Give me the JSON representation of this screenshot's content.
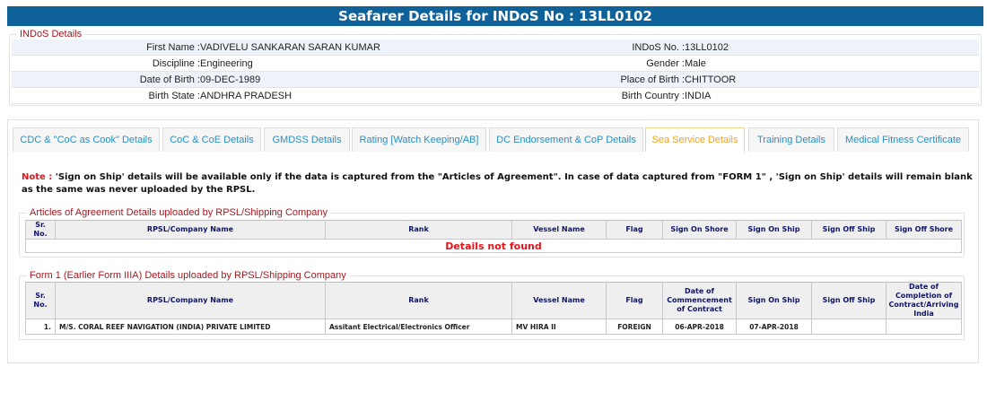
{
  "header": {
    "title": "Seafarer Details for INDoS No : 13LL0102"
  },
  "indos": {
    "legend": "INDoS Details",
    "rows": [
      {
        "l1": "First Name :",
        "v1": "VADIVELU SANKARAN SARAN KUMAR",
        "l2": "INDoS No. :",
        "v2": "13LL0102"
      },
      {
        "l1": "Discipline :",
        "v1": "Engineering",
        "l2": "Gender :",
        "v2": "Male"
      },
      {
        "l1": "Date of Birth :",
        "v1": "09-DEC-1989",
        "l2": "Place of Birth :",
        "v2": "CHITTOOR"
      },
      {
        "l1": "Birth State :",
        "v1": "ANDHRA PRADESH",
        "l2": "Birth Country :",
        "v2": "INDIA"
      }
    ]
  },
  "tabs": [
    "CDC & \"CoC as Cook\" Details",
    "CoC & CoE Details",
    "GMDSS Details",
    "Rating [Watch Keeping/AB]",
    "DC Endorsement & CoP Details",
    "Sea Service Details",
    "Training Details",
    "Medical Fitness Certificate"
  ],
  "note": {
    "label": "Note :",
    "text": " 'Sign on Ship' details will be available only if the data is captured from the \"Articles of Agreement\". In case of data captured from \"FORM 1\" , 'Sign on Ship' details will remain blank as the same was never uploaded by the RPSL."
  },
  "aoa": {
    "legend": "Articles of Agreement Details uploaded by RPSL/Shipping Company",
    "headers": [
      "Sr. No.",
      "RPSL/Company Name",
      "Rank",
      "Vessel Name",
      "Flag",
      "Sign On Shore",
      "Sign On Ship",
      "Sign Off Ship",
      "Sign Off Shore"
    ],
    "empty": "Details not found"
  },
  "form1": {
    "legend": "Form 1 (Earlier Form IIIA) Details uploaded by RPSL/Shipping Company",
    "headers": [
      "Sr. No.",
      "RPSL/Company Name",
      "Rank",
      "Vessel Name",
      "Flag",
      "Date of Commencement of Contract",
      "Sign On Ship",
      "Sign Off Ship",
      "Date of Completion of Contract/Arriving India"
    ],
    "rows": [
      [
        "1.",
        "M/S. CORAL REEF NAVIGATION (INDIA) PRIVATE LIMITED",
        "Assitant Electrical/Electronics Officer",
        "MV HIRA II",
        "FOREIGN",
        "06-APR-2018",
        "07-APR-2018",
        "",
        ""
      ]
    ]
  }
}
